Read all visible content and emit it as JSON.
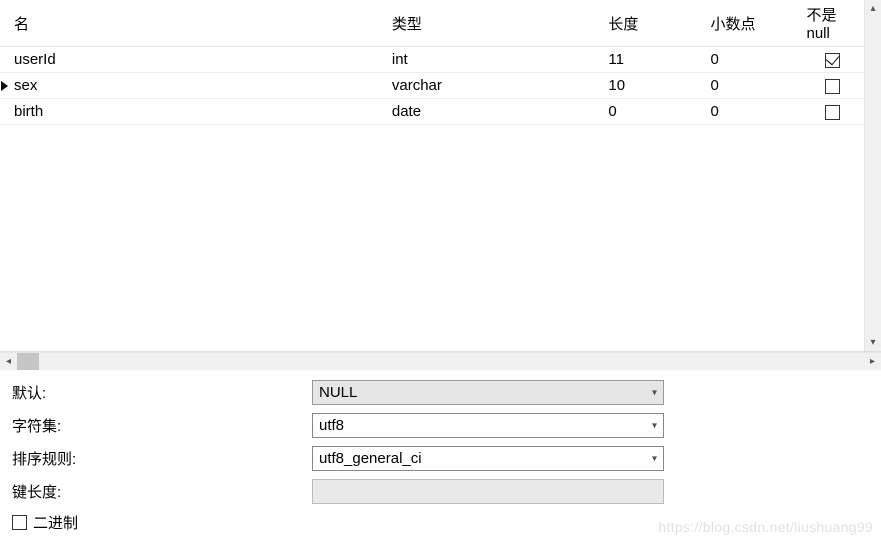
{
  "columns": {
    "name": "名",
    "type": "类型",
    "length": "长度",
    "decimals": "小数点",
    "notnull": "不是 null"
  },
  "rows": [
    {
      "name": "userId",
      "type": "int",
      "length": "11",
      "decimals": "0",
      "notnull": true,
      "current": false
    },
    {
      "name": "sex",
      "type": "varchar",
      "length": "10",
      "decimals": "0",
      "notnull": false,
      "current": true
    },
    {
      "name": "birth",
      "type": "date",
      "length": "0",
      "decimals": "0",
      "notnull": false,
      "current": false
    }
  ],
  "props": {
    "default_label": "默认:",
    "default_value": "NULL",
    "charset_label": "字符集:",
    "charset_value": "utf8",
    "collation_label": "排序规则:",
    "collation_value": "utf8_general_ci",
    "keylen_label": "键长度:",
    "keylen_value": "",
    "binary_label": "二进制"
  },
  "watermark": "https://blog.csdn.net/liushuang99"
}
